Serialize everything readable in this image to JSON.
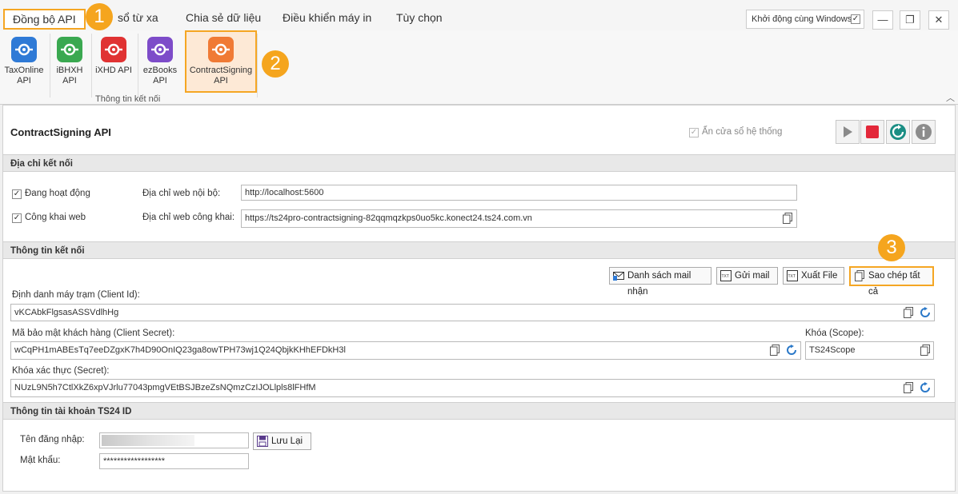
{
  "menu": {
    "tabs": [
      "Đồng bộ API",
      "sổ từ xa",
      "Chia sẻ dữ liệu",
      "Điều khiển máy in",
      "Tùy chọn"
    ],
    "startup_label": "Khởi động cùng Windows",
    "startup_checked": true
  },
  "badges": [
    "1",
    "2",
    "3"
  ],
  "ribbon": {
    "buttons": [
      {
        "line1": "TaxOnline",
        "line2": "API",
        "color": "#2f7ad6"
      },
      {
        "line1": "iBHXH",
        "line2": "API",
        "color": "#3aa850"
      },
      {
        "line1": "iXHD API",
        "line2": "",
        "color": "#e03232"
      },
      {
        "line1": "ezBooks",
        "line2": "API",
        "color": "#7d4cc9"
      },
      {
        "line1": "ContractSigning",
        "line2": "API",
        "color": "#f07a35"
      }
    ],
    "group_label": "Thông tin kết nối"
  },
  "panel": {
    "title": "ContractSigning API",
    "hide_tray_label": "Ẩn cửa sổ hệ thống",
    "controls": [
      "play-icon",
      "stop-icon",
      "refresh-icon",
      "info-icon"
    ]
  },
  "address": {
    "header": "Địa chỉ kết nối",
    "active_label": "Đang hoạt động",
    "public_label": "Công khai web",
    "local_label": "Địa chỉ web nội bộ:",
    "local_value": "http://localhost:5600",
    "public_addr_label": "Địa chỉ web công khai:",
    "public_value": "https://ts24pro-contractsigning-82qqmqzkps0uo5kc.konect24.ts24.com.vn"
  },
  "connection": {
    "header": "Thông tin kết nối",
    "buttons": [
      "Danh sách mail nhận",
      "Gửi mail",
      "Xuất File",
      "Sao chép tất cả"
    ],
    "client_id_label": "Định danh máy trạm (Client Id):",
    "client_id_value": "vKCAbkFlgsasASSVdlhHg",
    "client_secret_label": "Mã bảo mật khách hàng (Client Secret):",
    "client_secret_value": "wCqPH1mABEsTq7eeDZgxK7h4D90OnIQ23ga8owTPH73wj1Q24QbjkKHhEFDkH3l",
    "scope_label": "Khóa (Scope):",
    "scope_value": "TS24Scope",
    "secret_label": "Khóa xác thực (Secret):",
    "secret_value": "NUzL9N5h7CtlXkZ6xpVJrlu77043pmgVEtBSJBzeZsNQmzCzIJOLlpls8lFHfM"
  },
  "account": {
    "header": "Thông tin tài khoản TS24 ID",
    "username_label": "Tên đăng nhập:",
    "password_label": "Mật khẩu:",
    "password_value": "******************",
    "save_label": "Lưu Lại"
  }
}
